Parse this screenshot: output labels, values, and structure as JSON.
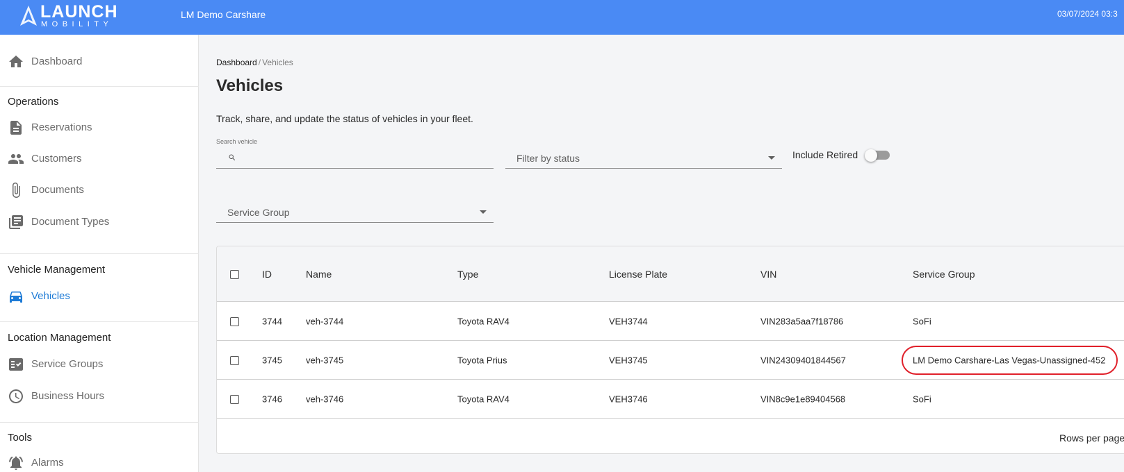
{
  "topbar": {
    "logo_word": "LAUNCH",
    "logo_sub": "MOBILITY",
    "app_name": "LM Demo Carshare",
    "datetime": "03/07/2024 03:3"
  },
  "sidebar": {
    "dashboard": {
      "label": "Dashboard",
      "icon": "home-icon"
    },
    "sections": {
      "operations": "Operations",
      "vehicle_management": "Vehicle Management",
      "location_management": "Location Management",
      "tools": "Tools"
    },
    "items": {
      "reservations": {
        "label": "Reservations",
        "icon": "document-icon"
      },
      "customers": {
        "label": "Customers",
        "icon": "people-icon"
      },
      "documents": {
        "label": "Documents",
        "icon": "paperclip-icon"
      },
      "document_types": {
        "label": "Document Types",
        "icon": "library-icon"
      },
      "vehicles": {
        "label": "Vehicles",
        "icon": "car-icon",
        "active": true
      },
      "service_groups": {
        "label": "Service Groups",
        "icon": "checklist-icon"
      },
      "business_hours": {
        "label": "Business Hours",
        "icon": "clock-icon"
      },
      "alarms": {
        "label": "Alarms",
        "icon": "alarm-icon"
      }
    }
  },
  "breadcrumb": {
    "root": "Dashboard",
    "separator": "/",
    "current": "Vehicles"
  },
  "page": {
    "title": "Vehicles",
    "description": "Track, share, and update the status of vehicles in your fleet."
  },
  "filters": {
    "search_label": "Search vehicle",
    "search_value": "",
    "status_placeholder": "Filter by status",
    "include_retired_label": "Include Retired",
    "include_retired": false,
    "service_group_placeholder": "Service Group"
  },
  "table": {
    "columns": {
      "id": "ID",
      "name": "Name",
      "type": "Type",
      "license_plate": "License Plate",
      "vin": "VIN",
      "service_group": "Service Group"
    },
    "rows": [
      {
        "id": "3744",
        "name": "veh-3744",
        "type": "Toyota RAV4",
        "license_plate": "VEH3744",
        "vin": "VIN283a5aa7f18786",
        "service_group": "SoFi"
      },
      {
        "id": "3745",
        "name": "veh-3745",
        "type": "Toyota Prius",
        "license_plate": "VEH3745",
        "vin": "VIN24309401844567",
        "service_group": "LM Demo Carshare-Las Vegas-Unassigned-452"
      },
      {
        "id": "3746",
        "name": "veh-3746",
        "type": "Toyota RAV4",
        "license_plate": "VEH3746",
        "vin": "VIN8c9e1e89404568",
        "service_group": "SoFi"
      }
    ],
    "rows_per_page_label": "Rows per page"
  },
  "colors": {
    "topbar": "#4a8af4",
    "active_nav": "#1e7bd6",
    "highlight_ring": "#e0202a"
  }
}
